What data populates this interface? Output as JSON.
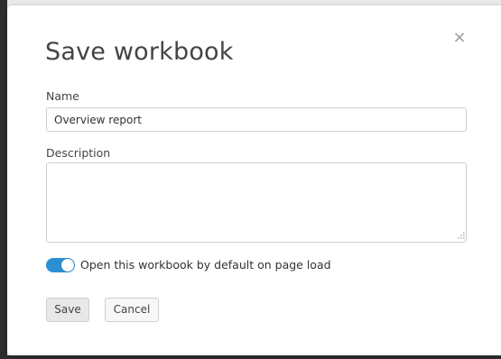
{
  "dialog": {
    "title": "Save workbook",
    "close_glyph": "×",
    "close_icon": "close-icon"
  },
  "form": {
    "name_label": "Name",
    "name_value": "Overview report",
    "description_label": "Description",
    "description_value": "",
    "default_toggle": {
      "label": "Open this workbook by default on page load",
      "checked": true,
      "accent_color": "#2b8fd1"
    }
  },
  "actions": {
    "save_label": "Save",
    "cancel_label": "Cancel"
  }
}
